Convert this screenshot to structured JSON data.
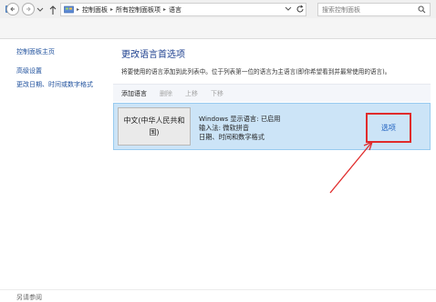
{
  "window": {
    "title": "语言"
  },
  "address": {
    "breadcrumb": [
      "控制面板",
      "所有控制面板项",
      "语言"
    ],
    "search_placeholder": "搜索控制面板"
  },
  "sidebar": {
    "items": [
      "控制面板主页",
      "高级设置",
      "更改日期、时间或数字格式"
    ],
    "see_also": "另请参阅"
  },
  "main": {
    "title": "更改语言首选项",
    "description": "将要使用的语言添加到此列表中。位于列表第一位的语言为主语言(即你希望看到并最常使用的语言)。",
    "toolbar": [
      "添加语言",
      "删除",
      "上移",
      "下移"
    ],
    "language": {
      "name": "中文(中华人民共和国)",
      "info": [
        "Windows 显示语言: 已启用",
        "输入法: 微软拼音",
        "日期、时间和数字格式"
      ],
      "options_label": "选项"
    }
  },
  "colors": {
    "selection": "#cce4f7",
    "highlight_box": "#e02b2b",
    "link": "#1d5fbf",
    "heading": "#1c3f8f"
  }
}
